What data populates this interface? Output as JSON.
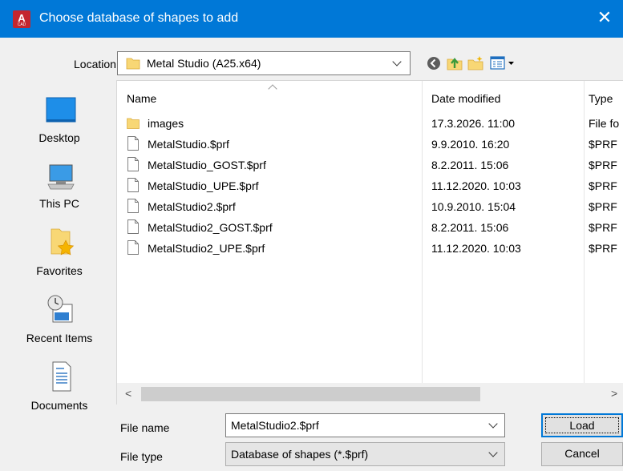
{
  "window": {
    "title": "Choose database of shapes to add",
    "app_icon_letter": "A",
    "app_icon_caption": "CAD"
  },
  "location": {
    "label": "Location",
    "value": "Metal Studio (A25.x64)"
  },
  "toolbar": {
    "icons": [
      "back-icon",
      "up-folder-icon",
      "new-folder-icon",
      "view-menu-icon"
    ]
  },
  "places": [
    {
      "label": "Desktop",
      "icon": "desktop-icon"
    },
    {
      "label": "This PC",
      "icon": "computer-icon"
    },
    {
      "label": "Favorites",
      "icon": "favorites-icon"
    },
    {
      "label": "Recent Items",
      "icon": "recent-items-icon"
    },
    {
      "label": "Documents",
      "icon": "documents-icon"
    }
  ],
  "file_list": {
    "columns": {
      "name": "Name",
      "date": "Date modified",
      "type": "Type"
    },
    "rows": [
      {
        "name": "images",
        "date": "17.3.2026. 11:00",
        "type": "File fo",
        "kind": "folder"
      },
      {
        "name": "MetalStudio.$prf",
        "date": "9.9.2010. 16:20",
        "type": "$PRF",
        "kind": "file"
      },
      {
        "name": "MetalStudio_GOST.$prf",
        "date": "8.2.2011. 15:06",
        "type": "$PRF",
        "kind": "file"
      },
      {
        "name": "MetalStudio_UPE.$prf",
        "date": "11.12.2020. 10:03",
        "type": "$PRF",
        "kind": "file"
      },
      {
        "name": "MetalStudio2.$prf",
        "date": "10.9.2010. 15:04",
        "type": "$PRF",
        "kind": "file"
      },
      {
        "name": "MetalStudio2_GOST.$prf",
        "date": "8.2.2011. 15:06",
        "type": "$PRF",
        "kind": "file"
      },
      {
        "name": "MetalStudio2_UPE.$prf",
        "date": "11.12.2020. 10:03",
        "type": "$PRF",
        "kind": "file"
      }
    ]
  },
  "file_name": {
    "label": "File name",
    "value": "MetalStudio2.$prf"
  },
  "file_type": {
    "label": "File type",
    "value": "Database of shapes  (*.$prf)"
  },
  "buttons": {
    "load": "Load",
    "cancel": "Cancel"
  },
  "colors": {
    "titlebar": "#0078d7",
    "app_icon": "#c4262e",
    "folder": "#f8d775"
  }
}
